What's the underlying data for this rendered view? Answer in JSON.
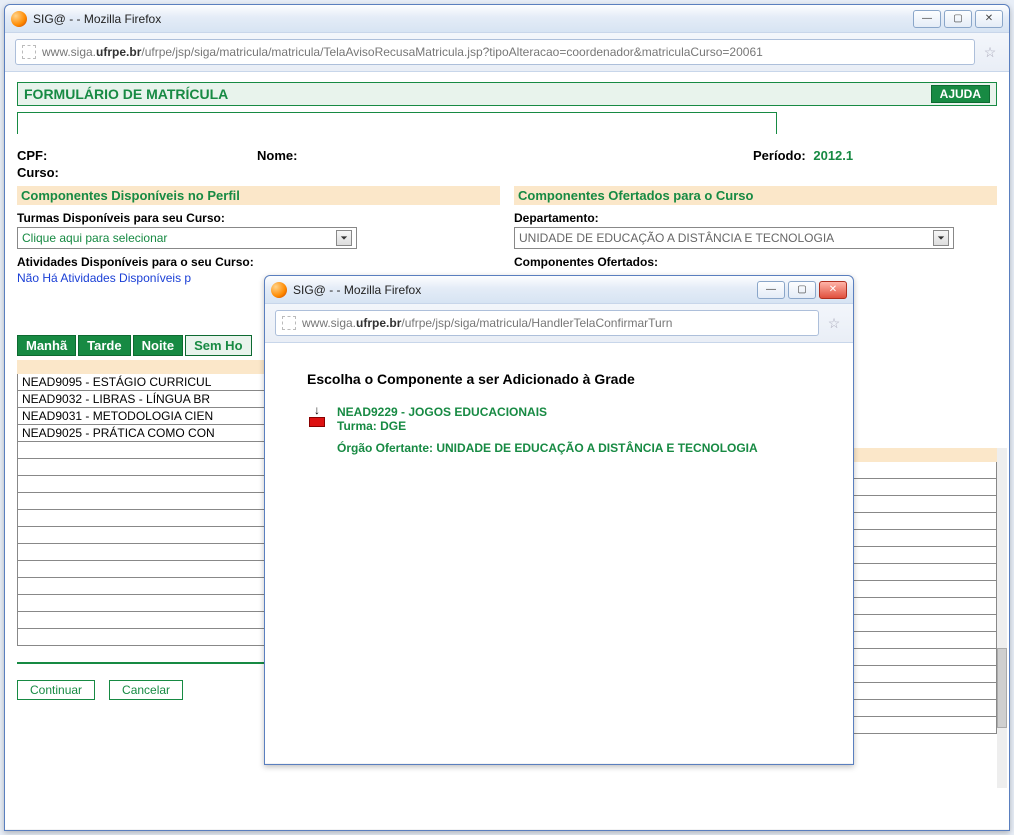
{
  "mainWindow": {
    "title": "SIG@ - - Mozilla Firefox",
    "url_pre": "www.siga.",
    "url_bold": "ufrpe.br",
    "url_post": "/ufrpe/jsp/siga/matricula/matricula/TelaAvisoRecusaMatricula.jsp?tipoAlteracao=coordenador&matriculaCurso=20061"
  },
  "page": {
    "formTitle": "FORMULÁRIO DE MATRÍCULA",
    "ajuda": "AJUDA",
    "cpfLabel": "CPF:",
    "nomeLabel": "Nome:",
    "periodoLabel": "Período:",
    "periodoValue": "2012.1",
    "cursoLabel": "Curso:",
    "left": {
      "section": "Componentes Disponíveis no Perfil",
      "turmasLabel": "Turmas Disponíveis para seu Curso:",
      "turmasSelect": "Clique aqui para selecionar",
      "ativLabel": "Atividades Disponíveis para o seu Curso:",
      "ativNone": "Não Há Atividades Disponíveis p"
    },
    "right": {
      "section": "Componentes Ofertados para o Curso",
      "depLabel": "Departamento:",
      "depSelect": "UNIDADE DE EDUCAÇÃO A DISTÂNCIA E TECNOLOGIA",
      "ofertadosLabel": "Componentes Ofertados:"
    },
    "tabs": {
      "manha": "Manhã",
      "tarde": "Tarde",
      "noite": "Noite",
      "sem": "Sem Ho"
    },
    "listRows": [
      "NEAD9095 - ESTÁGIO CURRICUL",
      "NEAD9032 - LIBRAS - LÍNGUA BR",
      "NEAD9031 - METODOLOGIA CIEN",
      "NEAD9025 - PRÁTICA COMO CON"
    ],
    "continuar": "Continuar",
    "cancelar": "Cancelar"
  },
  "popup": {
    "title": "SIG@ - - Mozilla Firefox",
    "url_pre": "www.siga.",
    "url_bold": "ufrpe.br",
    "url_post": "/ufrpe/jsp/siga/matricula/HandlerTelaConfirmarTurn",
    "heading": "Escolha o Componente a ser Adicionado à Grade",
    "componentCode": "NEAD9229 - JOGOS EDUCACIONAIS",
    "turmaLabel": "Turma: DGE",
    "orgaoLabel": "Órgão Ofertante: UNIDADE DE EDUCAÇÃO A DISTÂNCIA E TECNOLOGIA"
  }
}
